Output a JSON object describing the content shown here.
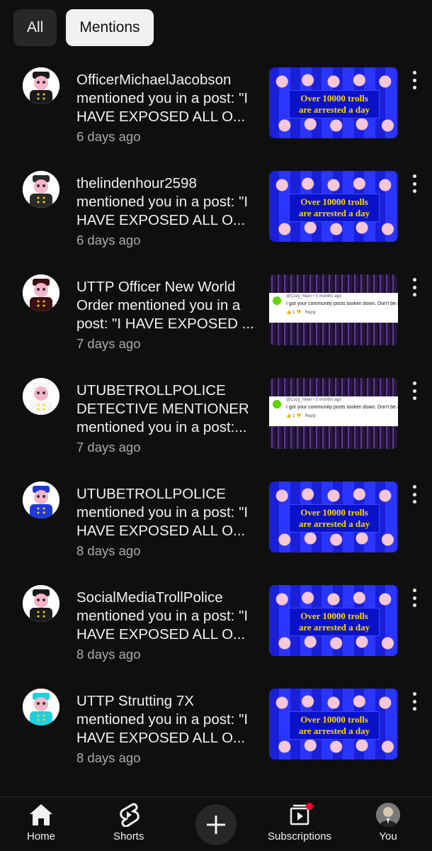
{
  "filters": {
    "all": "All",
    "mentions": "Mentions"
  },
  "notifications": [
    {
      "message": "OfficerMichaelJacobson mentioned you in a post: \"I HAVE EXPOSED ALL O...",
      "time": "6 days ago",
      "avatar_color": "#1a1a1a",
      "thumb": "banner"
    },
    {
      "message": "thelindenhour2598 mentioned you in a post: \"I HAVE EXPOSED ALL O...",
      "time": "6 days ago",
      "avatar_color": "#2a2a2a",
      "thumb": "banner"
    },
    {
      "message": "UTTP Officer New World Order mentioned you in a post: \"I HAVE EXPOSED ...",
      "time": "7 days ago",
      "avatar_color": "#3a1010",
      "thumb": "comment"
    },
    {
      "message": "UTUBETROLLPOLICE DETECTIVE MENTIONER mentioned you in a post:...",
      "time": "7 days ago",
      "avatar_color": "#f5f5f5",
      "thumb": "comment"
    },
    {
      "message": "UTUBETROLLPOLICE mentioned you in a post: \"I HAVE EXPOSED ALL O...",
      "time": "8 days ago",
      "avatar_color": "#1d3ad8",
      "thumb": "banner"
    },
    {
      "message": "SocialMediaTrollPolice mentioned you in a post: \"I HAVE EXPOSED ALL O...",
      "time": "8 days ago",
      "avatar_color": "#1a1a1a",
      "thumb": "banner"
    },
    {
      "message": "UTTP Strutting 7X mentioned you in a post: \"I HAVE EXPOSED ALL O...",
      "time": "8 days ago",
      "avatar_color": "#1fd0e0",
      "thumb": "banner"
    }
  ],
  "thumb_banner": {
    "line1": "Over 10000 trolls",
    "line2": "are arrested a day"
  },
  "thumb_comment": {
    "user": "@Cozy_Main",
    "ago": "5 months ago",
    "text": "I got your community posts tooken down. Don't be a hacker.",
    "reply": "Reply"
  },
  "nav": {
    "home": "Home",
    "shorts": "Shorts",
    "subscriptions": "Subscriptions",
    "you": "You"
  }
}
